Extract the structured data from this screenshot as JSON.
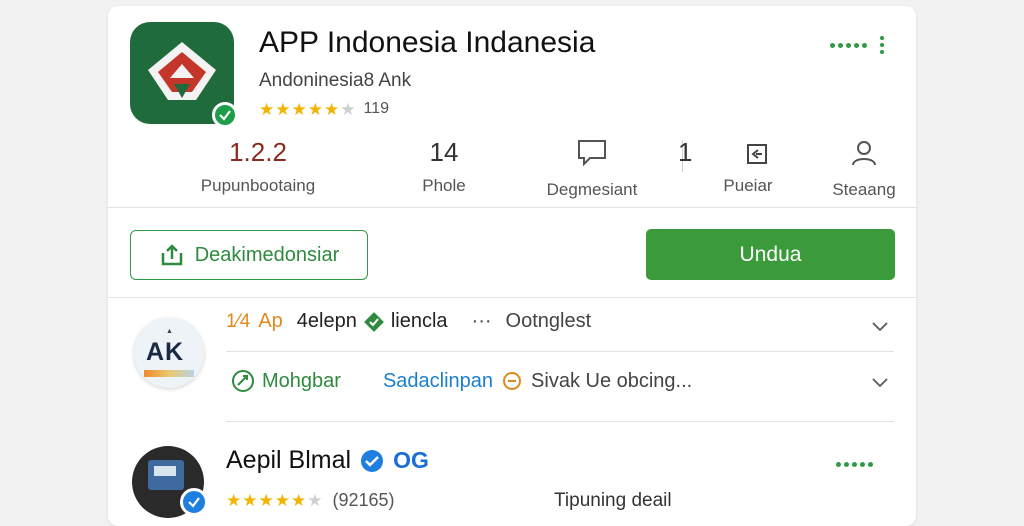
{
  "app": {
    "title": "APP Indonesia Indanesia",
    "subtitle": "Andoninesia8 Ank",
    "rating_stars": 4.5,
    "rating_count": "119"
  },
  "stats": [
    {
      "value": "1.2.2",
      "label": "Pupunbootaing"
    },
    {
      "value": "14",
      "label": "Phole"
    },
    {
      "value": "",
      "label": "Degmesiant",
      "icon": "comment-icon"
    },
    {
      "value": "1",
      "label": "Pueiar",
      "icon": "compare-icon"
    },
    {
      "value": "",
      "label": "Steaang",
      "icon": "person-icon"
    }
  ],
  "actions": {
    "secondary_label": "Deakimedonsiar",
    "primary_label": "Undua"
  },
  "list": {
    "row1": {
      "lead": "1⁄4",
      "a1": "Ap",
      "a2": "4elepn",
      "a3": "liencla",
      "sep": "···",
      "right": "Ootnglest"
    },
    "row2": {
      "c1": "Mohgbar",
      "c2": "Sadaclinpan",
      "c3": "Sivak Ue obcing..."
    },
    "avatar_text": "AK"
  },
  "developer": {
    "name": "Aepil Blmal",
    "badge_text": "OG",
    "rating_stars": 4.5,
    "rating_count": "(92165)",
    "detail": "Tipuning deail"
  },
  "colors": {
    "accent_green": "#3b9a3a",
    "app_icon_green": "#1f6b3c",
    "star": "#f2b400",
    "link_blue": "#1a7fd0"
  }
}
